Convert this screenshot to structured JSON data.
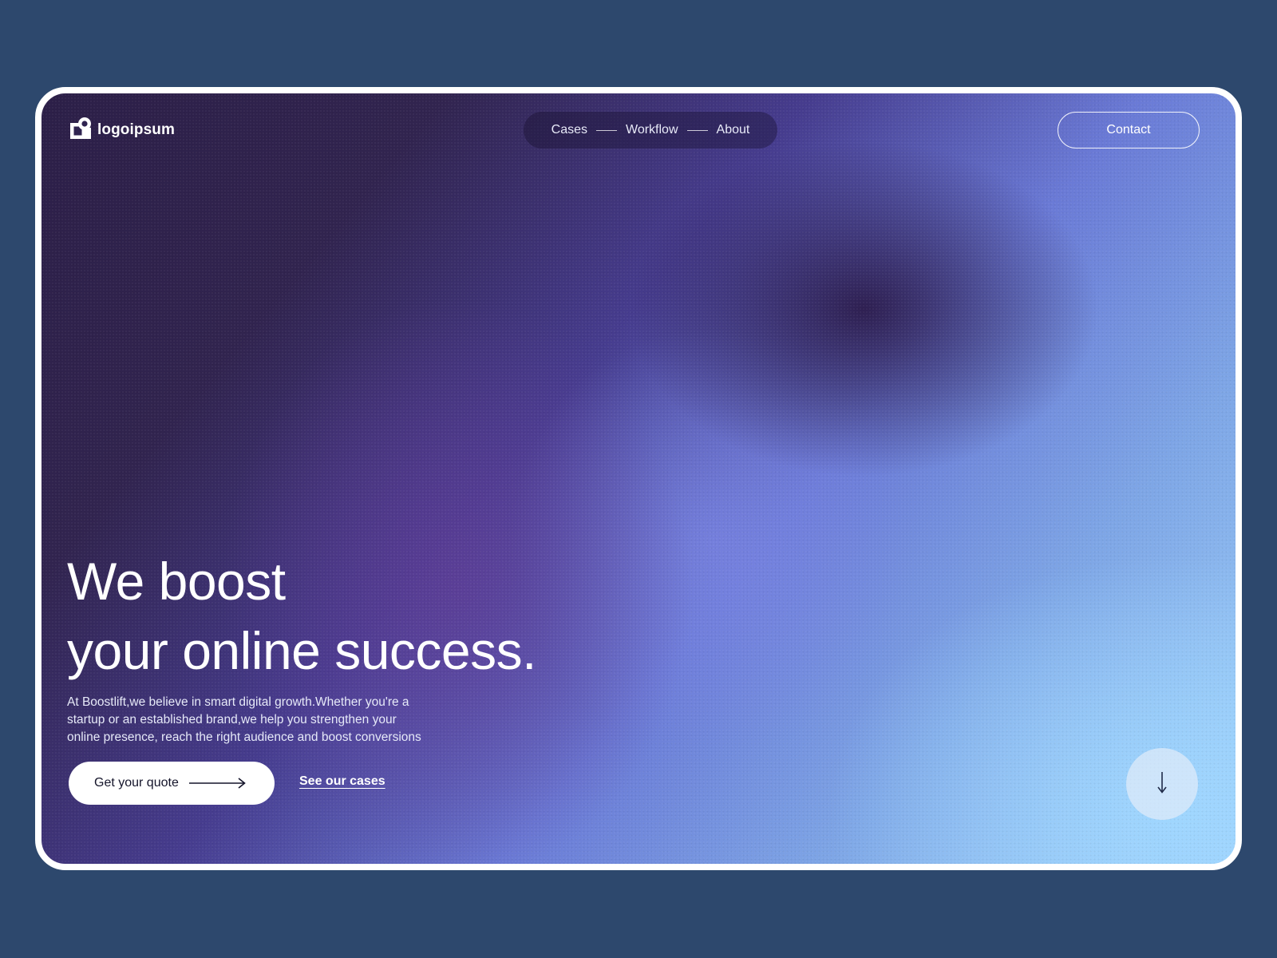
{
  "brand": {
    "name": "logoipsum",
    "logo_icon": "logo-mark-icon"
  },
  "nav": {
    "items": [
      {
        "label": "Cases"
      },
      {
        "label": "Workflow"
      },
      {
        "label": "About"
      }
    ],
    "separator_icon": "dash-line"
  },
  "header": {
    "contact_label": "Contact"
  },
  "hero": {
    "headline_line1": "We boost",
    "headline_line2": "your online success.",
    "description_line1": "At Boostlift,we believe in smart digital growth.Whether you're a",
    "description_line2": "startup or an established brand,we help you strengthen your",
    "description_line3": "online presence, reach the right audience and boost conversions",
    "primary_cta": "Get your quote",
    "primary_cta_icon": "arrow-right-icon",
    "secondary_cta": "See our cases",
    "scroll_icon": "arrow-down-icon"
  },
  "colors": {
    "page_background": "#2d486d",
    "frame_border": "#ffffff",
    "gradient_dark": "#2c1f48",
    "gradient_mid": "#6a7ad6",
    "gradient_light": "#9fd2fb",
    "cta_background": "#ffffff",
    "cta_text": "#14142a"
  }
}
